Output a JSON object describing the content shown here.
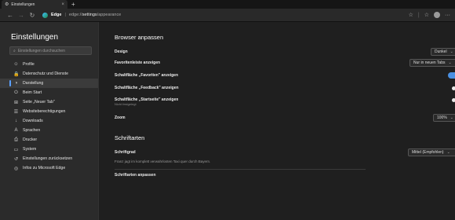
{
  "tab": {
    "title": "Einstellungen",
    "close": "×",
    "new_tab": "+"
  },
  "toolbar": {
    "back": "←",
    "forward": "→",
    "refresh": "↻",
    "brand": "Edge",
    "separator": "|",
    "url_prefix": "edge://",
    "url_host": "settings",
    "url_path": "/appearance",
    "star": "☆",
    "favorites": "☆",
    "more": "···"
  },
  "sidebar": {
    "title": "Einstellungen",
    "search_placeholder": "Einstellungen durchsuchen",
    "items": [
      {
        "label": "Profile",
        "icon": "person-icon",
        "glyph": "☺"
      },
      {
        "label": "Datenschutz und Dienste",
        "icon": "lock-icon",
        "glyph": "🔒"
      },
      {
        "label": "Darstellung",
        "icon": "palette-icon",
        "glyph": "◑",
        "active": true
      },
      {
        "label": "Beim Start",
        "icon": "power-icon",
        "glyph": "⏻"
      },
      {
        "label": "Seite „Neuer Tab\"",
        "icon": "newtab-icon",
        "glyph": "⊞"
      },
      {
        "label": "Websiteberechtigungen",
        "icon": "permissions-icon",
        "glyph": "☰"
      },
      {
        "label": "Downloads",
        "icon": "download-icon",
        "glyph": "↓"
      },
      {
        "label": "Sprachen",
        "icon": "language-icon",
        "glyph": "A"
      },
      {
        "label": "Drucker",
        "icon": "printer-icon",
        "glyph": "⎙"
      },
      {
        "label": "System",
        "icon": "system-icon",
        "glyph": "▭"
      },
      {
        "label": "Einstellungen zurücksetzen",
        "icon": "reset-icon",
        "glyph": "↺"
      },
      {
        "label": "Infos zu Microsoft Edge",
        "icon": "edge-icon",
        "glyph": "◎"
      }
    ]
  },
  "browser": {
    "title": "Browser anpassen",
    "design_label": "Design",
    "design_value": "Dunkel",
    "favbar_label": "Favoritenleiste anzeigen",
    "favbar_value": "Nur in neuen Tabs",
    "fav_btn_label": "Schaltfläche „Favoriten\" anzeigen",
    "fav_btn_on": true,
    "feedback_btn_label": "Schaltfläche „Feedback\" anzeigen",
    "feedback_btn_on": false,
    "home_btn_label": "Schaltfläche „Startseite\" anzeigen",
    "home_btn_sub": "Nicht festgelegt",
    "home_btn_on": false,
    "zoom_label": "Zoom",
    "zoom_value": "100%"
  },
  "fonts": {
    "title": "Schriftarten",
    "size_label": "Schriftgrad",
    "size_value": "Mittel (Empfohlen)",
    "sample": "Franz jagt im komplett verwahrlosten Taxi quer durch Bayern.",
    "customize_label": "Schriftarten anpassen",
    "chevron": "›"
  },
  "colors": {
    "accent": "#4a90e2",
    "background": "#1f1f1f",
    "sidebar": "#2b2b2b"
  }
}
